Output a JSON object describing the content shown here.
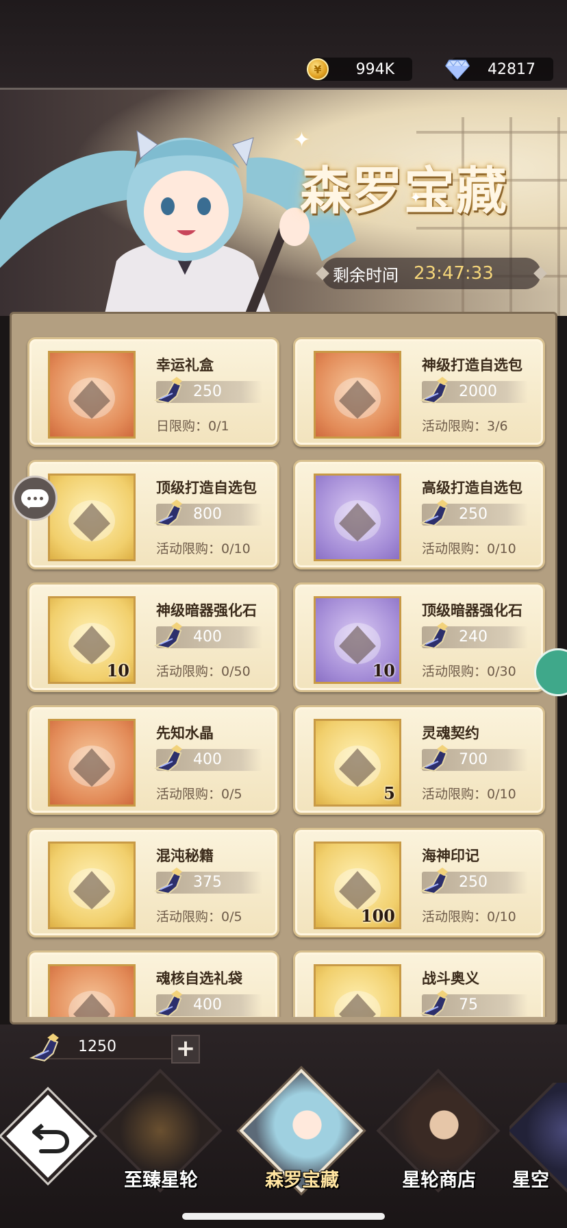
{
  "header": {
    "gold": "994K",
    "gems": "42817"
  },
  "banner": {
    "title": "森罗宝藏",
    "timer_label": "剩余时间",
    "timer_value": "23:47:33"
  },
  "items": [
    {
      "name": "幸运礼盒",
      "price": "250",
      "limit": "日限购：0/1",
      "thumb": "orange",
      "qty": ""
    },
    {
      "name": "神级打造自选包",
      "price": "2000",
      "limit": "活动限购：3/6",
      "thumb": "orange",
      "qty": ""
    },
    {
      "name": "顶级打造自选包",
      "price": "800",
      "limit": "活动限购：0/10",
      "thumb": "gold",
      "qty": ""
    },
    {
      "name": "高级打造自选包",
      "price": "250",
      "limit": "活动限购：0/10",
      "thumb": "purple",
      "qty": ""
    },
    {
      "name": "神级暗器强化石",
      "price": "400",
      "limit": "活动限购：0/50",
      "thumb": "gold",
      "qty": "10"
    },
    {
      "name": "顶级暗器强化石",
      "price": "240",
      "limit": "活动限购：0/30",
      "thumb": "purple",
      "qty": "10"
    },
    {
      "name": "先知水晶",
      "price": "400",
      "limit": "活动限购：0/5",
      "thumb": "orange",
      "qty": ""
    },
    {
      "name": "灵魂契约",
      "price": "700",
      "limit": "活动限购：0/10",
      "thumb": "gold",
      "qty": "5"
    },
    {
      "name": "混沌秘籍",
      "price": "375",
      "limit": "活动限购：0/5",
      "thumb": "gold",
      "qty": ""
    },
    {
      "name": "海神印记",
      "price": "250",
      "limit": "活动限购：0/10",
      "thumb": "gold",
      "qty": "100"
    },
    {
      "name": "魂核自选礼袋",
      "price": "400",
      "limit": "",
      "thumb": "orange",
      "qty": ""
    },
    {
      "name": "战斗奥义",
      "price": "75",
      "limit": "",
      "thumb": "gold",
      "qty": ""
    }
  ],
  "bottom": {
    "token_count": "1250",
    "plus_label": "+",
    "tabs": [
      {
        "label": "至臻星轮",
        "active": false
      },
      {
        "label": "森罗宝藏",
        "active": true
      },
      {
        "label": "星轮商店",
        "active": false
      },
      {
        "label": "星空",
        "active": false
      }
    ]
  },
  "colors": {
    "accent_gold": "#f5d67a",
    "card_bg": "#fbf3dc",
    "panel": "#b39f81"
  },
  "icons": [
    "coin-icon",
    "diamond-icon",
    "token-icon",
    "chat-icon",
    "back-icon",
    "plus-icon"
  ]
}
